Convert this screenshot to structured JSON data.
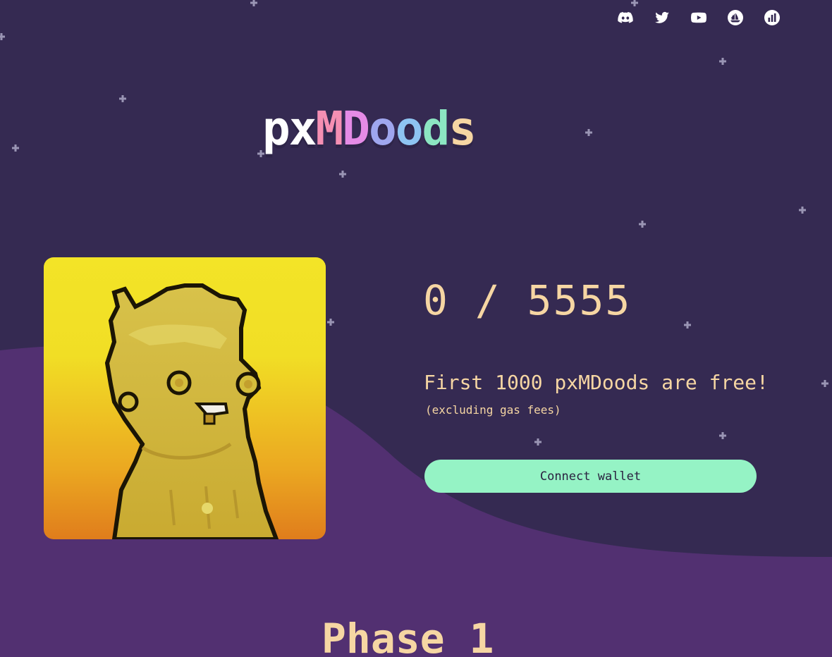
{
  "social": [
    {
      "name": "discord-icon"
    },
    {
      "name": "twitter-icon"
    },
    {
      "name": "youtube-icon"
    },
    {
      "name": "opensea-icon"
    },
    {
      "name": "stats-icon"
    }
  ],
  "logo": {
    "letters": [
      {
        "ch": "p",
        "color": "#ffffff"
      },
      {
        "ch": "x",
        "color": "#ffffff"
      },
      {
        "ch": "M",
        "color": "#f58fb3"
      },
      {
        "ch": "D",
        "color": "#e58be6"
      },
      {
        "ch": "o",
        "color": "#9fa6ee"
      },
      {
        "ch": "o",
        "color": "#8ec4f2"
      },
      {
        "ch": "d",
        "color": "#8ce6c2"
      },
      {
        "ch": "s",
        "color": "#f6d6a3"
      }
    ]
  },
  "mint": {
    "counter": "0 / 5555",
    "free_text": "First 1000 pxMDoods are free!",
    "gas_text": "(excluding gas fees)",
    "connect_label": "Connect wallet"
  },
  "phase": {
    "title": "Phase 1"
  },
  "colors": {
    "background": "#352a52",
    "wave": "#523071",
    "text": "#f6d6a3",
    "button": "#95f3c5"
  }
}
